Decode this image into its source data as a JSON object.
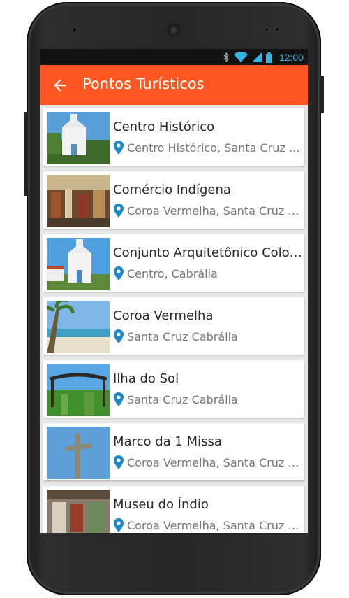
{
  "status_bar": {
    "time": "12:00",
    "icons": [
      "bluetooth-icon",
      "wifi-icon",
      "signal-icon",
      "battery-icon"
    ]
  },
  "app_bar": {
    "title": "Pontos Turísticos",
    "back_icon": "arrow-back-icon",
    "color": "#ff5722"
  },
  "items": [
    {
      "title": "Centro Histórico",
      "location": "Centro Histórico, Santa Cruz Cabrália"
    },
    {
      "title": "Comércio Indígena",
      "location": "Coroa Vermelha, Santa Cruz Cabrália"
    },
    {
      "title": "Conjunto Arquitetônico Colonial",
      "location": "Centro, Cabrália"
    },
    {
      "title": "Coroa Vermelha",
      "location": "Santa Cruz Cabrália"
    },
    {
      "title": "Ilha do Sol",
      "location": "Santa Cruz Cabrália"
    },
    {
      "title": "Marco da 1 Missa",
      "location": "Coroa Vermelha, Santa Cruz Cabrália"
    },
    {
      "title": "Museu do Índio",
      "location": "Coroa Vermelha, Santa Cruz Cabrália"
    }
  ],
  "colors": {
    "pin": "#1e88c7",
    "status_icons": "#33b5e5"
  }
}
